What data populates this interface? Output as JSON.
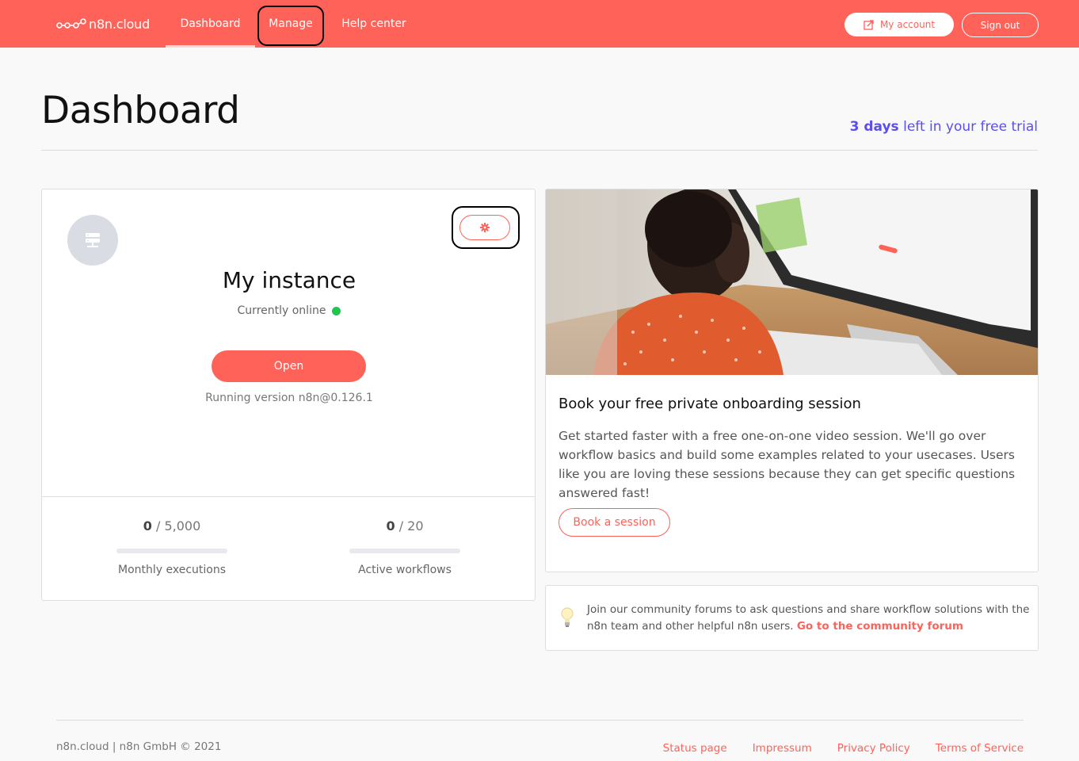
{
  "nav": {
    "logo_text": "n8n.cloud",
    "items": [
      {
        "label": "Dashboard"
      },
      {
        "label": "Manage"
      },
      {
        "label": "Help center"
      }
    ],
    "my_account": "My account",
    "sign_out": "Sign out"
  },
  "header": {
    "title": "Dashboard",
    "trial_days": "3 days",
    "trial_suffix": " left in your free trial"
  },
  "instance": {
    "title": "My instance",
    "status": "Currently online",
    "open_label": "Open",
    "version": "Running version n8n@0.126.1",
    "stats": [
      {
        "used": "0",
        "limit": " / 5,000",
        "label": "Monthly executions",
        "fraction": 0
      },
      {
        "used": "0",
        "limit": " / 20",
        "label": "Active workflows",
        "fraction": 0
      }
    ]
  },
  "onboarding": {
    "title": "Book your free private onboarding session",
    "text": "Get started faster with a free one-on-one video session. We'll go over workflow basics and build some examples related to your usecases. Users like you are loving these sessions because they can get specific questions answered fast!",
    "button": "Book a session"
  },
  "community": {
    "text": "Join our community forums to ask questions and share workflow solutions with the n8n team and other helpful n8n users. ",
    "link": "Go to the community forum"
  },
  "footer": {
    "copyright": "n8n.cloud | n8n GmbH © 2021",
    "links": [
      "Status page",
      "Impressum",
      "Privacy Policy",
      "Terms of Service"
    ]
  },
  "colors": {
    "brand": "#ff6259",
    "trial_accent": "#5b4ef0",
    "online": "#1ec74f"
  }
}
